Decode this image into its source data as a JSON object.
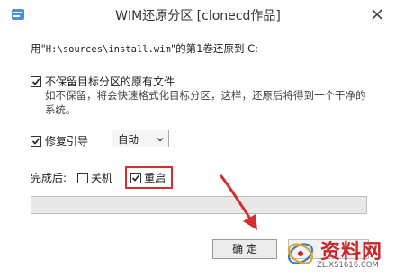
{
  "window": {
    "title": "WIM还原分区 [clonecd作品]",
    "app_icon": "app-icon",
    "close_icon": "close-icon"
  },
  "restore_line": {
    "prefix": "用\"",
    "path": "H:\\sources\\install.wim",
    "suffix": "\"的第1卷还原到 C:"
  },
  "keep_files": {
    "label": "不保留目标分区的原有文件",
    "checked": true,
    "hint_line1": "如不保留，将会快速格式化目标分区，这样，还原后将得到一个干净的",
    "hint_line2": "系统。"
  },
  "fix_boot": {
    "label": "修复引导",
    "checked": true,
    "dropdown_value": "自动"
  },
  "after_completion": {
    "label": "完成后:",
    "shutdown_label": "关机",
    "shutdown_checked": false,
    "reboot_label": "重启",
    "reboot_checked": true
  },
  "progress": {
    "value": 0
  },
  "buttons": {
    "ok_label": "确 定"
  },
  "watermark": {
    "name": "资料网",
    "url": "ZL.XS1616.COM"
  },
  "colors": {
    "highlight": "#d32f2f",
    "arrow": "#d32f2f",
    "watermark": "#c6282c"
  }
}
